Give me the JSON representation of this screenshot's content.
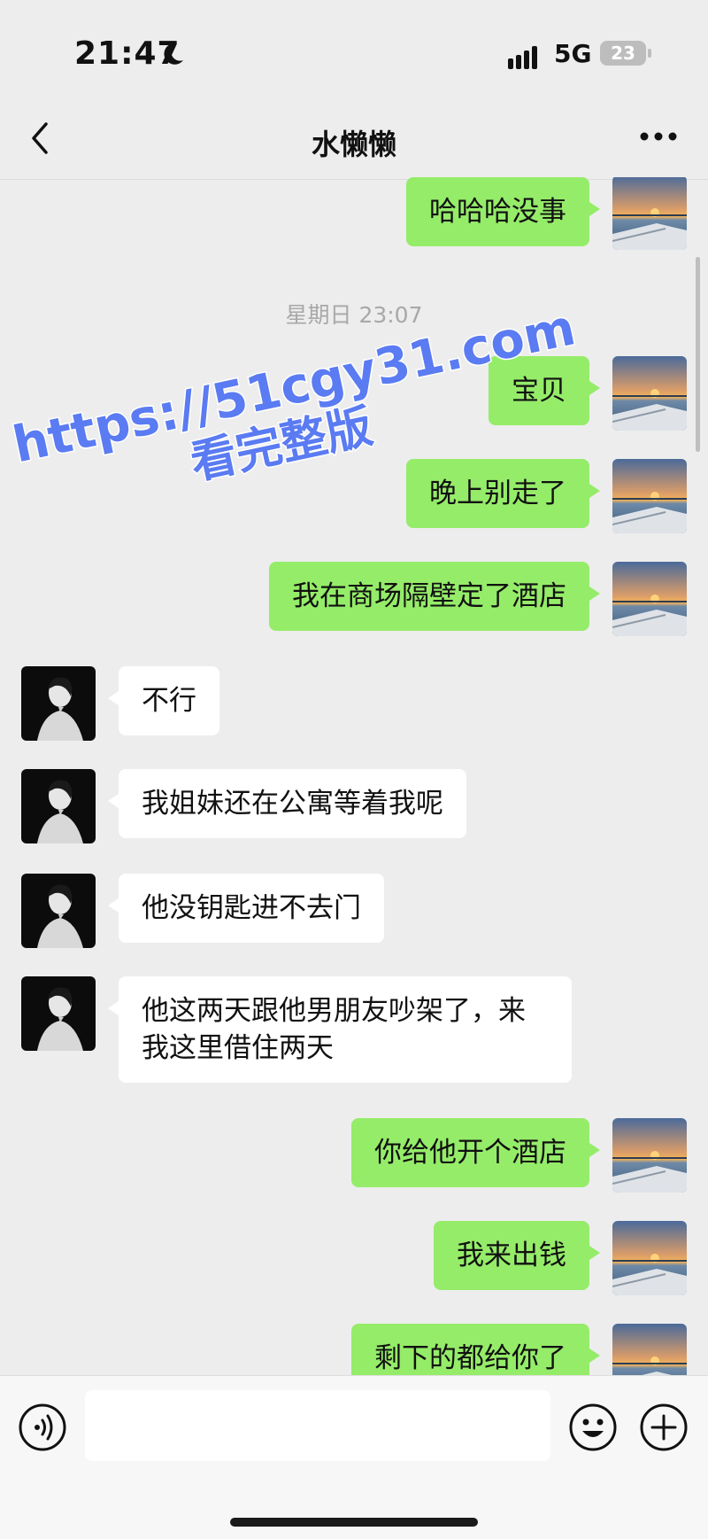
{
  "status_bar": {
    "time": "21:47",
    "network": "5G",
    "battery": "23"
  },
  "header": {
    "title": "水懒懒"
  },
  "chat": {
    "timestamp": "星期日 23:07",
    "messages": [
      {
        "from": "me",
        "text": "哈哈哈没事"
      },
      {
        "from": "me",
        "text": "宝贝"
      },
      {
        "from": "me",
        "text": "晚上别走了"
      },
      {
        "from": "me",
        "text": "我在商场隔壁定了酒店"
      },
      {
        "from": "her",
        "text": "不行"
      },
      {
        "from": "her",
        "text": "我姐妹还在公寓等着我呢"
      },
      {
        "from": "her",
        "text": "他没钥匙进不去门"
      },
      {
        "from": "her",
        "text": "他这两天跟他男朋友吵架了，来\n我这里借住两天"
      },
      {
        "from": "me",
        "text": "你给他开个酒店"
      },
      {
        "from": "me",
        "text": "我来出钱"
      },
      {
        "from": "me",
        "text": "剩下的都给你了"
      }
    ]
  },
  "watermark": {
    "line1": "https://51cgy31.com",
    "line2": "看完整版"
  },
  "input_bar": {
    "placeholder": ""
  },
  "colors": {
    "my_bubble": "#95ec69",
    "their_bubble": "#ffffff",
    "background": "#ededed",
    "watermark": "#5a7bf2"
  },
  "icons": [
    "back-icon",
    "more-icon",
    "voice-icon",
    "emoji-icon",
    "plus-icon",
    "moon-icon",
    "signal-icon",
    "battery-icon"
  ]
}
